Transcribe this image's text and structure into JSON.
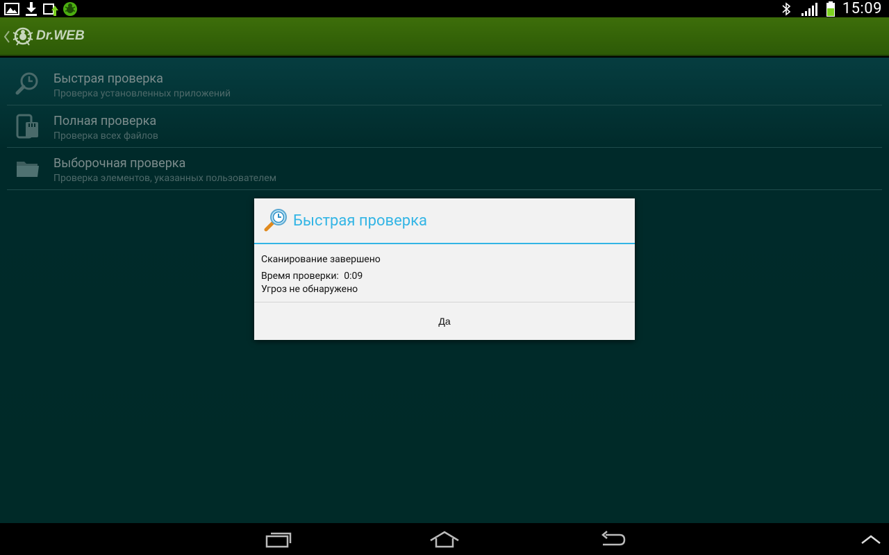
{
  "status_bar": {
    "time": "15:09",
    "left_icons": [
      "gallery-icon",
      "download-icon",
      "sync-update-icon",
      "drweb-spider-icon"
    ],
    "right_icons": [
      "bluetooth-icon",
      "signal-icon",
      "battery-icon"
    ]
  },
  "action_bar": {
    "app_name": "Dr.WEB",
    "accent": "#3d6e0a"
  },
  "scan_list": {
    "items": [
      {
        "title": "Быстрая проверка",
        "subtitle": "Проверка установленных приложений",
        "icon": "quick-scan-icon"
      },
      {
        "title": "Полная проверка",
        "subtitle": "Проверка всех файлов",
        "icon": "full-scan-icon"
      },
      {
        "title": "Выборочная проверка",
        "subtitle": "Проверка элементов, указанных пользователем",
        "icon": "folder-icon"
      }
    ]
  },
  "dialog": {
    "title": "Быстрая проверка",
    "status": "Сканирование завершено",
    "time_label": "Время проверки:",
    "time_value": "0:09",
    "result": "Угроз не обнаружено",
    "ok_label": "Да",
    "accent": "#33b5e5"
  },
  "nav_bar": {
    "buttons": [
      "recent-apps-icon",
      "home-icon",
      "back-icon",
      "menu-up-icon"
    ]
  }
}
